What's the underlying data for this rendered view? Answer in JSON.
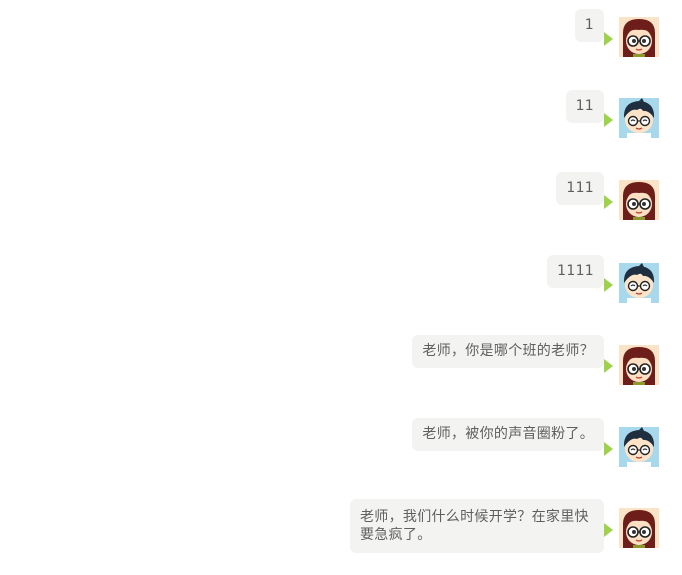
{
  "messages": [
    {
      "text": "1",
      "sender": "girl"
    },
    {
      "text": "11",
      "sender": "boy"
    },
    {
      "text": "111",
      "sender": "girl"
    },
    {
      "text": "1111",
      "sender": "boy"
    },
    {
      "text": "老师，你是哪个班的老师？",
      "sender": "girl"
    },
    {
      "text": "老师，被你的声音圈粉了。",
      "sender": "boy"
    },
    {
      "text": "老师，我们什么时候开学？在家里快要急疯了。",
      "sender": "girl"
    }
  ],
  "colors": {
    "bubble_bg": "#f3f3f1",
    "bubble_text": "#5f5f5f",
    "pointer": "#9ed24c"
  },
  "icons": {
    "girl": "girl-avatar-icon",
    "boy": "boy-avatar-icon"
  }
}
